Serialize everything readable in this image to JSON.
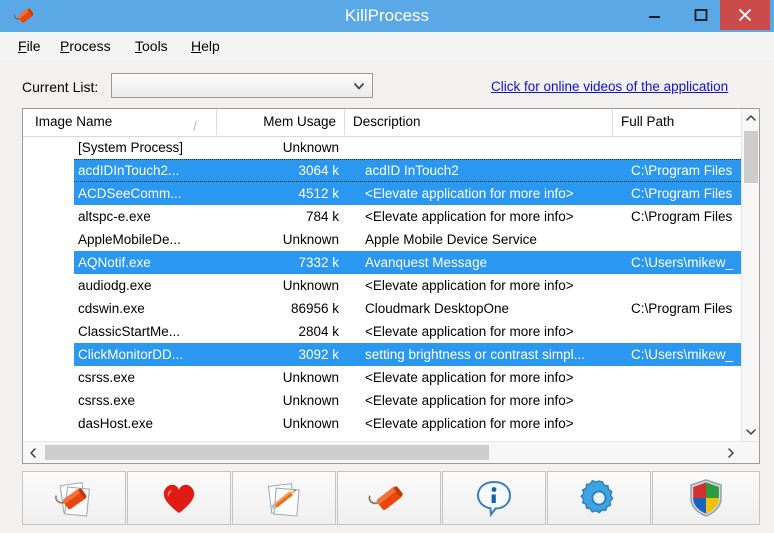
{
  "window": {
    "title": "KillProcess",
    "app_icon": "dynamite-icon",
    "controls": {
      "minimize": "–",
      "maximize": "❑",
      "close": "×"
    },
    "close_color": "#cb4b4b",
    "titlebar_color": "#5aa8e6"
  },
  "menu": [
    {
      "label": "File",
      "mnemonic": "F"
    },
    {
      "label": "Process",
      "mnemonic": "P"
    },
    {
      "label": "Tools",
      "mnemonic": "T"
    },
    {
      "label": "Help",
      "mnemonic": "H"
    }
  ],
  "toolbar_top": {
    "current_list_label": "Current List:",
    "current_list_value": "",
    "current_list_placeholder": "",
    "online_videos_link": "Click for online videos of the application",
    "link_color": "#1111cc"
  },
  "list": {
    "columns": [
      {
        "key": "image_name",
        "label": "Image Name",
        "sorted": true,
        "sort_glyph": "/"
      },
      {
        "key": "mem_usage",
        "label": "Mem Usage",
        "align": "right"
      },
      {
        "key": "description",
        "label": "Description"
      },
      {
        "key": "full_path",
        "label": "Full Path"
      }
    ],
    "selection_color": "#2a97f0",
    "rows": [
      {
        "image_name": "[System Process]",
        "mem_usage": "Unknown",
        "description": "",
        "full_path": "",
        "selected": false,
        "focused": false
      },
      {
        "image_name": "acdIDInTouch2...",
        "mem_usage": "3064 k",
        "description": "acdID InTouch2",
        "full_path": "C:\\Program Files",
        "selected": true,
        "focused": true
      },
      {
        "image_name": "ACDSeeComm...",
        "mem_usage": "4512 k",
        "description": "<Elevate application for more info>",
        "full_path": "C:\\Program Files",
        "selected": true,
        "focused": false
      },
      {
        "image_name": "altspc-e.exe",
        "mem_usage": "784 k",
        "description": "<Elevate application for more info>",
        "full_path": "C:\\Program Files",
        "selected": false,
        "focused": false
      },
      {
        "image_name": "AppleMobileDe...",
        "mem_usage": "Unknown",
        "description": "Apple Mobile Device Service",
        "full_path": "",
        "selected": false,
        "focused": false
      },
      {
        "image_name": "AQNotif.exe",
        "mem_usage": "7332 k",
        "description": "Avanquest Message",
        "full_path": "C:\\Users\\mikew_",
        "selected": true,
        "focused": false
      },
      {
        "image_name": "audiodg.exe",
        "mem_usage": "Unknown",
        "description": "<Elevate application for more info>",
        "full_path": "",
        "selected": false,
        "focused": false
      },
      {
        "image_name": "cdswin.exe",
        "mem_usage": "86956 k",
        "description": "Cloudmark DesktopOne",
        "full_path": "C:\\Program Files",
        "selected": false,
        "focused": false
      },
      {
        "image_name": "ClassicStartMe...",
        "mem_usage": "2804 k",
        "description": "<Elevate application for more info>",
        "full_path": "",
        "selected": false,
        "focused": false
      },
      {
        "image_name": "ClickMonitorDD...",
        "mem_usage": "3092 k",
        "description": "setting brightness or contrast simpl...",
        "full_path": "C:\\Users\\mikew_",
        "selected": true,
        "focused": false
      },
      {
        "image_name": "csrss.exe",
        "mem_usage": "Unknown",
        "description": "<Elevate application for more info>",
        "full_path": "",
        "selected": false,
        "focused": false
      },
      {
        "image_name": "csrss.exe",
        "mem_usage": "Unknown",
        "description": "<Elevate application for more info>",
        "full_path": "",
        "selected": false,
        "focused": false
      },
      {
        "image_name": "dasHost.exe",
        "mem_usage": "Unknown",
        "description": "<Elevate application for more info>",
        "full_path": "",
        "selected": false,
        "focused": false
      }
    ]
  },
  "bottom_toolbar": {
    "buttons": [
      {
        "name": "kill-process-list-button",
        "icon": "dynamite-on-documents-icon"
      },
      {
        "name": "favorites-button",
        "icon": "red-heart-icon"
      },
      {
        "name": "edit-list-button",
        "icon": "pencil-on-document-icon"
      },
      {
        "name": "kill-process-button",
        "icon": "dynamite-icon"
      },
      {
        "name": "info-button",
        "icon": "info-bubble-icon"
      },
      {
        "name": "settings-button",
        "icon": "gear-icon"
      },
      {
        "name": "elevate-shield-button",
        "icon": "uac-shield-icon"
      }
    ]
  }
}
